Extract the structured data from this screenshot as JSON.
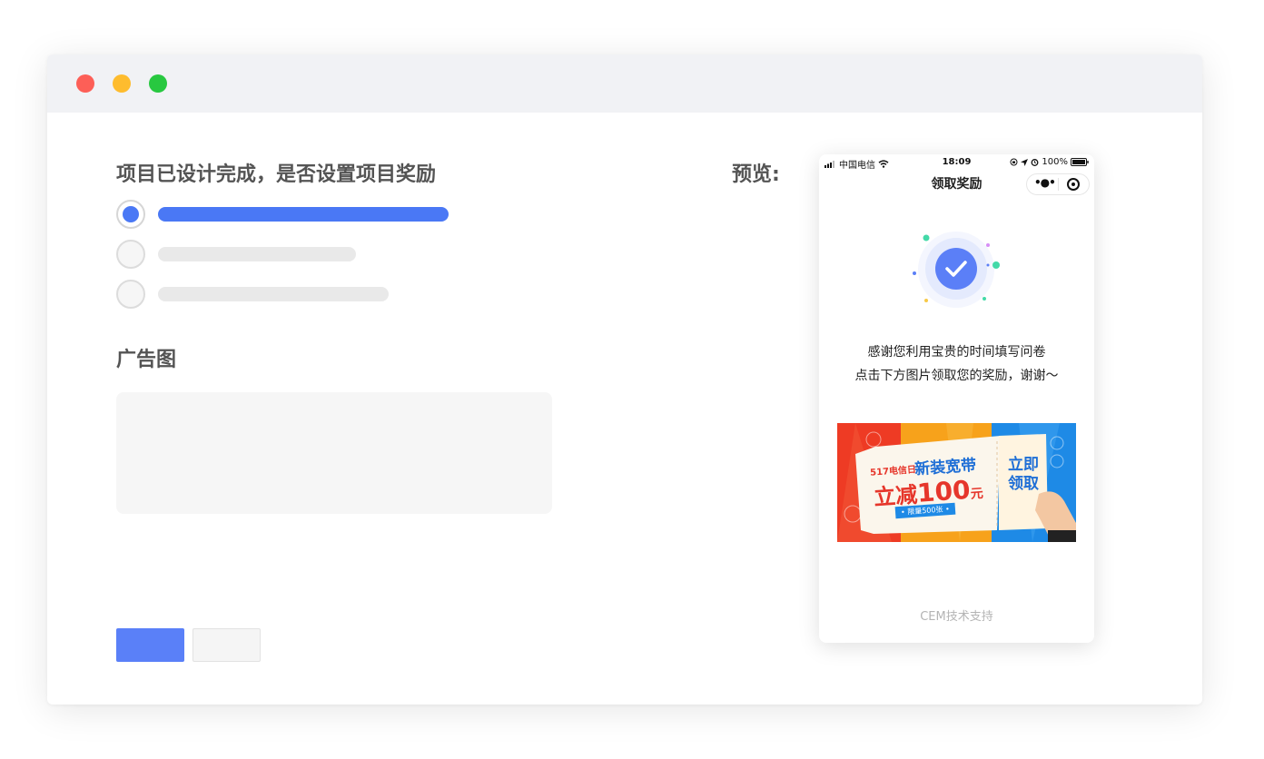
{
  "form": {
    "reward_question": "项目已设计完成，是否设置项目奖励",
    "options_selected_index": 0,
    "ad_image_label": "广告图"
  },
  "preview": {
    "label": "预览:",
    "status_bar": {
      "carrier": "中国电信",
      "time": "18:09",
      "battery": "100%"
    },
    "nav_title": "领取奖励",
    "thanks_line1": "感谢您利用宝贵的时间填写问卷",
    "thanks_line2": "点击下方图片领取您的奖励，谢谢～",
    "banner": {
      "tag": "517电信日",
      "headline": "新装宽带",
      "offer_prefix": "立减",
      "offer_amount": "100",
      "offer_unit": "元",
      "limit": "• 限量500张 •",
      "cta_line1": "立即",
      "cta_line2": "领取"
    },
    "footer": "CEM技术支持"
  },
  "colors": {
    "accent": "#4a78f5",
    "primary_button": "#5a80f8",
    "success_icon": "#5b7ff7"
  },
  "icons": [
    "signal-icon",
    "wifi-icon",
    "location-icon",
    "alarm-icon",
    "battery-icon",
    "more-icon",
    "target-icon",
    "check-icon"
  ]
}
